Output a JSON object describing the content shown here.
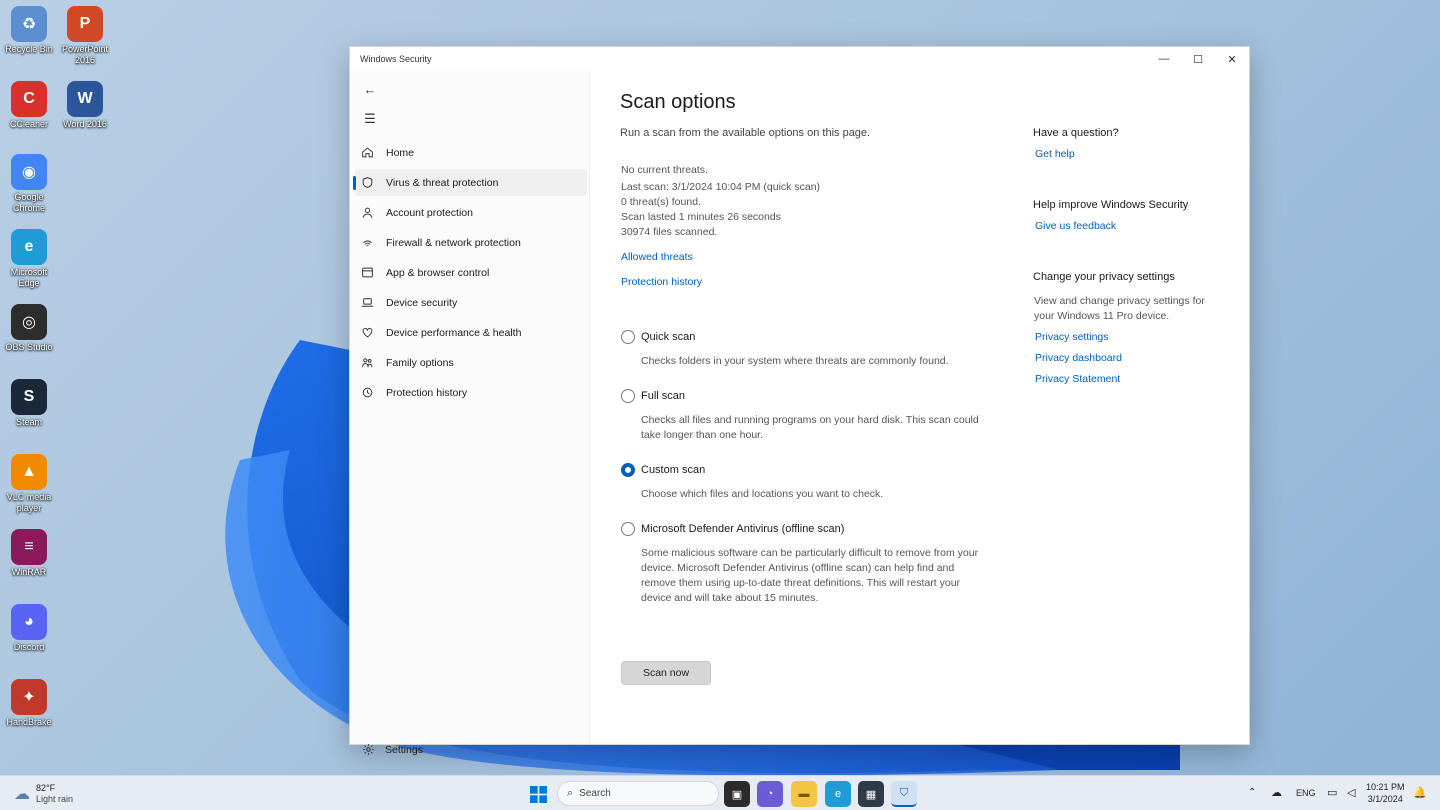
{
  "desktop": {
    "icons": [
      {
        "label": "Recycle Bin",
        "color": "#5b8fcf",
        "glyph": "♻"
      },
      {
        "label": "PowerPoint 2016",
        "color": "#d24726",
        "glyph": "P"
      },
      {
        "label": "CCleaner",
        "color": "#d9302c",
        "glyph": "C"
      },
      {
        "label": "Word 2016",
        "color": "#2b579a",
        "glyph": "W"
      },
      {
        "label": "Google Chrome",
        "color": "#4285f4",
        "glyph": "◉"
      },
      {
        "label": "Microsoft Edge",
        "color": "#1f9bd6",
        "glyph": "e"
      },
      {
        "label": "OBS Studio",
        "color": "#2d2d2d",
        "glyph": "◎"
      },
      {
        "label": "Steam",
        "color": "#1b2838",
        "glyph": "S"
      },
      {
        "label": "VLC media player",
        "color": "#f18a00",
        "glyph": "▲"
      },
      {
        "label": "WinRAR",
        "color": "#8b1a5a",
        "glyph": "≡"
      },
      {
        "label": "Discord",
        "color": "#5865f2",
        "glyph": "◕"
      },
      {
        "label": "HandBrake",
        "color": "#c0392b",
        "glyph": "✦"
      }
    ]
  },
  "window": {
    "title": "Windows Security",
    "controls": {
      "minimize": "—",
      "maximize": "☐",
      "close": "✕"
    }
  },
  "nav": {
    "back": "←",
    "menu": "☰",
    "items": [
      {
        "label": "Home",
        "icon": "home-icon"
      },
      {
        "label": "Virus & threat protection",
        "icon": "shield-icon",
        "active": true
      },
      {
        "label": "Account protection",
        "icon": "person-icon"
      },
      {
        "label": "Firewall & network protection",
        "icon": "wifi-icon"
      },
      {
        "label": "App & browser control",
        "icon": "browser-icon"
      },
      {
        "label": "Device security",
        "icon": "laptop-icon"
      },
      {
        "label": "Device performance & health",
        "icon": "heart-icon"
      },
      {
        "label": "Family options",
        "icon": "family-icon"
      },
      {
        "label": "Protection history",
        "icon": "history-icon"
      }
    ],
    "settings": "Settings"
  },
  "main": {
    "title": "Scan options",
    "subtitle": "Run a scan from the available options on this page.",
    "status": {
      "current": "No current threats.",
      "last_scan": "Last scan: 3/1/2024 10:04 PM (quick scan)",
      "found": "0 threat(s) found.",
      "duration": "Scan lasted 1 minutes 26 seconds",
      "files": "30974 files scanned."
    },
    "links": {
      "allowed": "Allowed threats",
      "history": "Protection history"
    },
    "options": [
      {
        "label": "Quick scan",
        "desc": "Checks folders in your system where threats are commonly found.",
        "checked": false
      },
      {
        "label": "Full scan",
        "desc": "Checks all files and running programs on your hard disk. This scan could take longer than one hour.",
        "checked": false
      },
      {
        "label": "Custom scan",
        "desc": "Choose which files and locations you want to check.",
        "checked": true
      },
      {
        "label": "Microsoft Defender Antivirus (offline scan)",
        "desc": "Some malicious software can be particularly difficult to remove from your device. Microsoft Defender Antivirus (offline scan) can help find and remove them using up-to-date threat definitions. This will restart your device and will take about 15 minutes.",
        "checked": false
      }
    ],
    "scan_button": "Scan now"
  },
  "side": {
    "question": {
      "heading": "Have a question?",
      "link": "Get help"
    },
    "improve": {
      "heading": "Help improve Windows Security",
      "link": "Give us feedback"
    },
    "privacy": {
      "heading": "Change your privacy settings",
      "text": "View and change privacy settings for your Windows 11 Pro device.",
      "links": [
        "Privacy settings",
        "Privacy dashboard",
        "Privacy Statement"
      ]
    }
  },
  "taskbar": {
    "weather": {
      "temp": "82°F",
      "condition": "Light rain"
    },
    "search_placeholder": "Search",
    "tray": {
      "lang": "ENG",
      "time": "10:21 PM",
      "date": "3/1/2024"
    }
  },
  "colors": {
    "accent": "#005fb8"
  }
}
